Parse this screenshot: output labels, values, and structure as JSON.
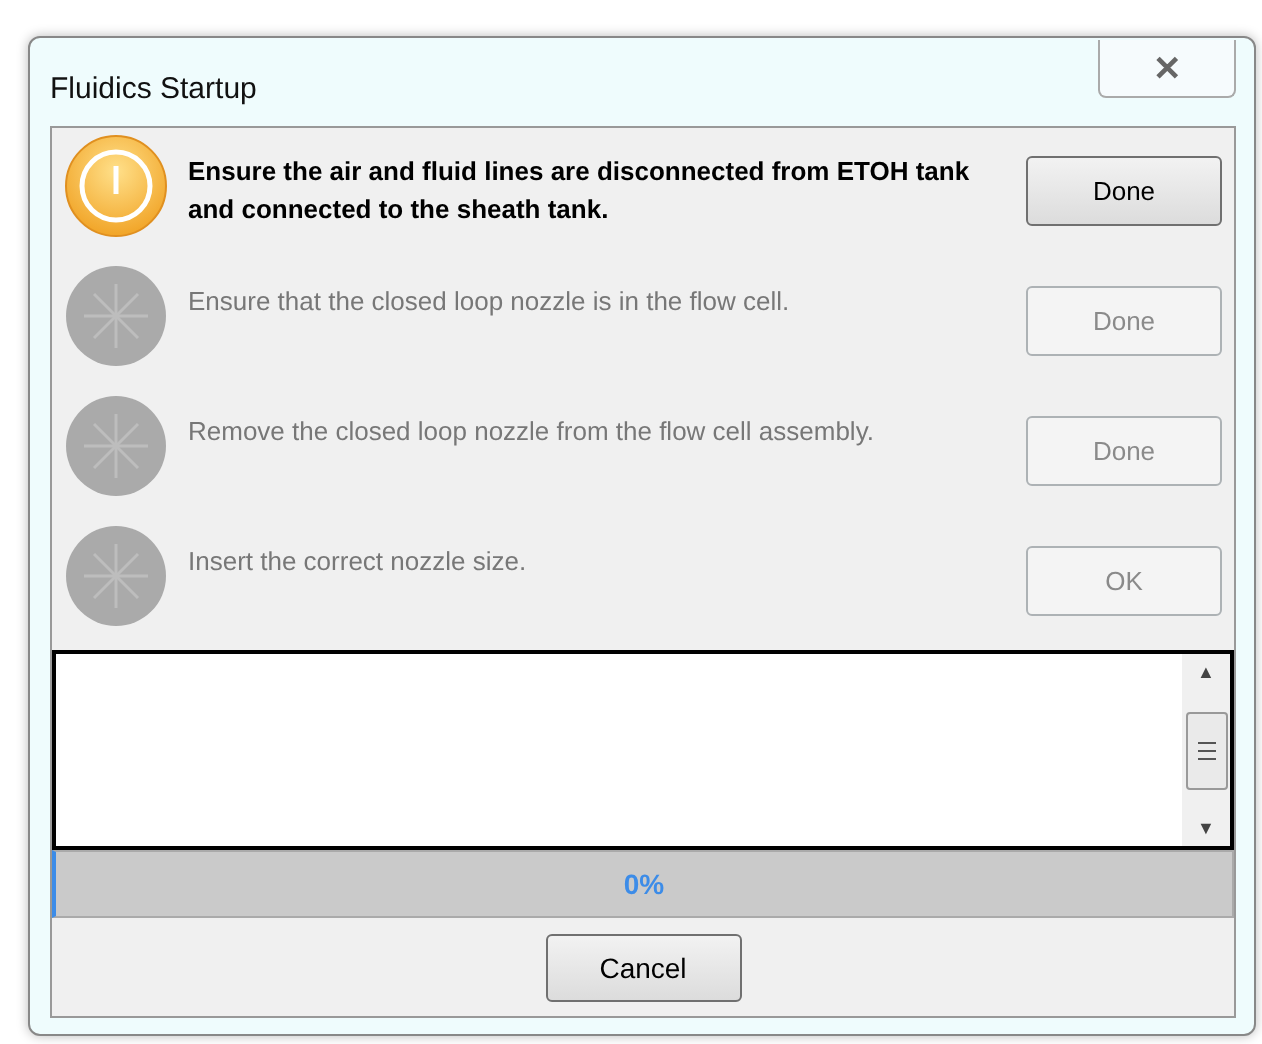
{
  "window": {
    "title": "Fluidics Startup",
    "close": "✕"
  },
  "steps": [
    {
      "text": "Ensure the air and fluid lines are disconnected from ETOH tank and connected to the sheath tank.",
      "active": true,
      "button": {
        "label": "Done",
        "disabled": false
      }
    },
    {
      "text": "Ensure that the closed loop nozzle is in the flow cell.",
      "active": false,
      "button": {
        "label": "Done",
        "disabled": true
      }
    },
    {
      "text": "Remove the closed loop nozzle from the flow cell assembly.",
      "active": false,
      "button": {
        "label": "Done",
        "disabled": true
      }
    },
    {
      "text": "Insert the correct nozzle size.",
      "active": false,
      "button": {
        "label": "OK",
        "disabled": true
      }
    }
  ],
  "log": {
    "scroll_up": "▲",
    "scroll_down": "▼"
  },
  "progress": {
    "level": 0,
    "text": "0%"
  },
  "cancel": "Cancel"
}
